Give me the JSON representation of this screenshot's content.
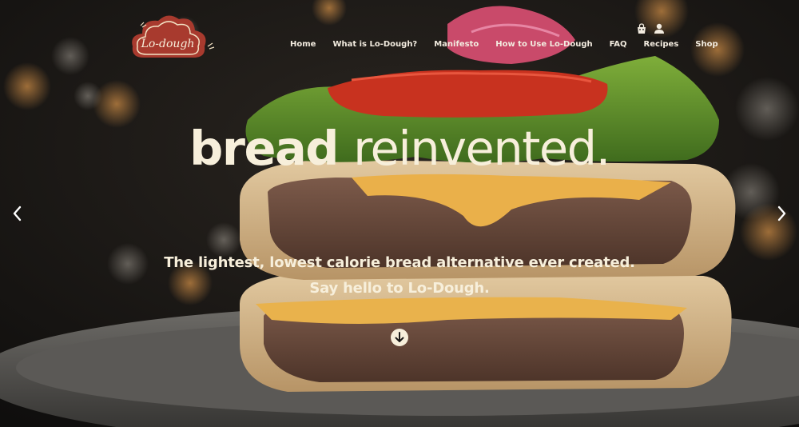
{
  "brand": {
    "logo_text": "Lo-dough"
  },
  "nav": {
    "items": [
      {
        "label": "Home"
      },
      {
        "label": "What is Lo-Dough?"
      },
      {
        "label": "Manifesto"
      },
      {
        "label": "How to Use Lo-Dough"
      },
      {
        "label": "FAQ"
      },
      {
        "label": "Recipes"
      },
      {
        "label": "Shop"
      }
    ]
  },
  "utility_icons": [
    "shopping-bag-icon",
    "account-icon"
  ],
  "hero": {
    "headline_bold": "bread",
    "headline_light": "reinvented.",
    "subline_1": "The lightest, lowest calorie bread alternative ever created.",
    "subline_2": "Say hello to Lo-Dough."
  },
  "carousel": {
    "prev_icon": "chevron-left-icon",
    "next_icon": "chevron-right-icon"
  },
  "scroll_icon": "arrow-down-circle-icon",
  "colors": {
    "text_cream": "#f7efdb",
    "logo_red": "#a83a2e",
    "background": "#141312"
  }
}
